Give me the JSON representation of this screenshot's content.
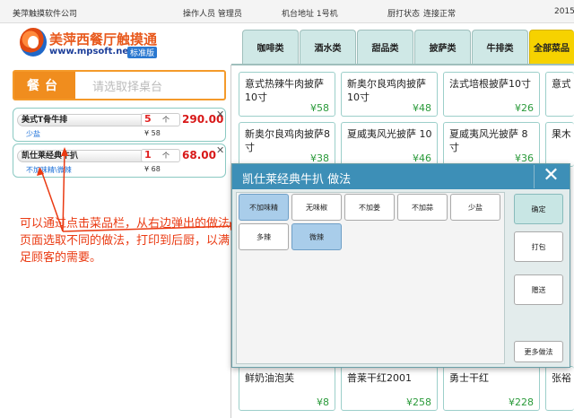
{
  "topbar": {
    "company": "美萍触摸软件公司",
    "operator": "操作人员 管理员",
    "terminal": "机台地址 1号机",
    "status_label": "厨打状态",
    "status_value": "连接正常",
    "year": "2015"
  },
  "brand": {
    "title": "美萍西餐厅触摸通",
    "url": "www.mpsoft.net.cn",
    "edition": "标准版"
  },
  "tabs": [
    {
      "label": "咖啡类"
    },
    {
      "label": "酒水类"
    },
    {
      "label": "甜品类"
    },
    {
      "label": "披萨类"
    },
    {
      "label": "牛排类"
    },
    {
      "label": "全部菜品"
    }
  ],
  "table_selector": {
    "tag": "餐台",
    "placeholder": "请选取择桌台"
  },
  "order_items": [
    {
      "name": "美式T骨牛排",
      "qty": "5",
      "unit": "个",
      "total": "290.00",
      "note": "少盐",
      "price": "¥ 58"
    },
    {
      "name": "凯仕莱经典牛扒",
      "qty": "1",
      "unit": "个",
      "total": "68.00",
      "note": "不加味精\\微辣",
      "price": "¥ 68"
    }
  ],
  "annotation": "可以通过点击菜品栏，从右边弹出的做法页面选取不同的做法，打印到后厨，以满足顾客的需要。",
  "dishes": [
    {
      "name": "意式热辣牛肉披萨10寸",
      "price": "¥58"
    },
    {
      "name": "新奥尔良鸡肉披萨10寸",
      "price": "¥48"
    },
    {
      "name": "法式培根披萨10寸",
      "price": "¥26"
    },
    {
      "name": "意式肥",
      "price": ""
    },
    {
      "name": "新奥尔良鸡肉披萨8寸",
      "price": "¥38"
    },
    {
      "name": "夏威夷风光披萨 10",
      "price": "¥46"
    },
    {
      "name": "夏威夷风光披萨 8寸",
      "price": "¥36"
    },
    {
      "name": "果木",
      "price": ""
    },
    {
      "name": "鲜奶油泡芙",
      "price": "¥8"
    },
    {
      "name": "普莱干红2001",
      "price": "¥258"
    },
    {
      "name": "勇士干红",
      "price": "¥228"
    },
    {
      "name": "张裕",
      "price": ""
    }
  ],
  "dialog": {
    "title": "凯仕莱经典牛扒  做法",
    "close": "✕",
    "options": [
      {
        "label": "不加味精",
        "selected": true
      },
      {
        "label": "无味椒",
        "selected": false
      },
      {
        "label": "不加姜",
        "selected": false
      },
      {
        "label": "不加蒜",
        "selected": false
      },
      {
        "label": "少盐",
        "selected": false
      },
      {
        "label": "多辣",
        "selected": false
      },
      {
        "label": "微辣",
        "selected": true
      }
    ],
    "confirm": "确定",
    "pack": "打包",
    "gift": "赠送",
    "more": "更多做法"
  },
  "colors": {
    "accent_orange": "#f08d1e",
    "dialog_header": "#3d8fb7",
    "tab_active": "#f6d200",
    "price_green": "#2a9a3a",
    "alert_red": "#ea3a12"
  }
}
